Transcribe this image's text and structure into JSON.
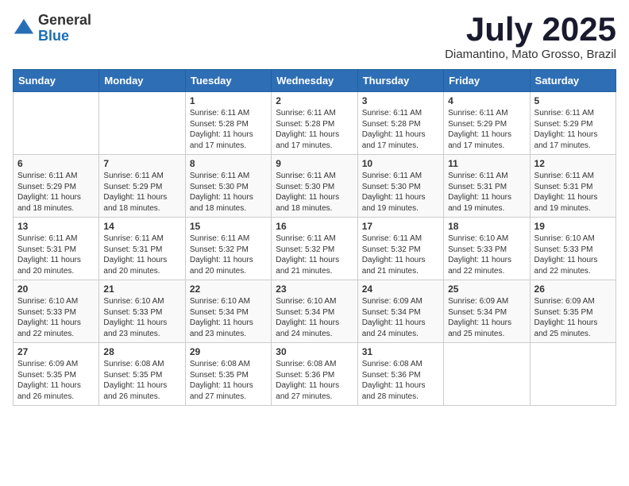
{
  "logo": {
    "general": "General",
    "blue": "Blue"
  },
  "title": "July 2025",
  "location": "Diamantino, Mato Grosso, Brazil",
  "days_of_week": [
    "Sunday",
    "Monday",
    "Tuesday",
    "Wednesday",
    "Thursday",
    "Friday",
    "Saturday"
  ],
  "weeks": [
    [
      {
        "day": "",
        "sunrise": "",
        "sunset": "",
        "daylight": ""
      },
      {
        "day": "",
        "sunrise": "",
        "sunset": "",
        "daylight": ""
      },
      {
        "day": "1",
        "sunrise": "Sunrise: 6:11 AM",
        "sunset": "Sunset: 5:28 PM",
        "daylight": "Daylight: 11 hours and 17 minutes."
      },
      {
        "day": "2",
        "sunrise": "Sunrise: 6:11 AM",
        "sunset": "Sunset: 5:28 PM",
        "daylight": "Daylight: 11 hours and 17 minutes."
      },
      {
        "day": "3",
        "sunrise": "Sunrise: 6:11 AM",
        "sunset": "Sunset: 5:28 PM",
        "daylight": "Daylight: 11 hours and 17 minutes."
      },
      {
        "day": "4",
        "sunrise": "Sunrise: 6:11 AM",
        "sunset": "Sunset: 5:29 PM",
        "daylight": "Daylight: 11 hours and 17 minutes."
      },
      {
        "day": "5",
        "sunrise": "Sunrise: 6:11 AM",
        "sunset": "Sunset: 5:29 PM",
        "daylight": "Daylight: 11 hours and 17 minutes."
      }
    ],
    [
      {
        "day": "6",
        "sunrise": "Sunrise: 6:11 AM",
        "sunset": "Sunset: 5:29 PM",
        "daylight": "Daylight: 11 hours and 18 minutes."
      },
      {
        "day": "7",
        "sunrise": "Sunrise: 6:11 AM",
        "sunset": "Sunset: 5:29 PM",
        "daylight": "Daylight: 11 hours and 18 minutes."
      },
      {
        "day": "8",
        "sunrise": "Sunrise: 6:11 AM",
        "sunset": "Sunset: 5:30 PM",
        "daylight": "Daylight: 11 hours and 18 minutes."
      },
      {
        "day": "9",
        "sunrise": "Sunrise: 6:11 AM",
        "sunset": "Sunset: 5:30 PM",
        "daylight": "Daylight: 11 hours and 18 minutes."
      },
      {
        "day": "10",
        "sunrise": "Sunrise: 6:11 AM",
        "sunset": "Sunset: 5:30 PM",
        "daylight": "Daylight: 11 hours and 19 minutes."
      },
      {
        "day": "11",
        "sunrise": "Sunrise: 6:11 AM",
        "sunset": "Sunset: 5:31 PM",
        "daylight": "Daylight: 11 hours and 19 minutes."
      },
      {
        "day": "12",
        "sunrise": "Sunrise: 6:11 AM",
        "sunset": "Sunset: 5:31 PM",
        "daylight": "Daylight: 11 hours and 19 minutes."
      }
    ],
    [
      {
        "day": "13",
        "sunrise": "Sunrise: 6:11 AM",
        "sunset": "Sunset: 5:31 PM",
        "daylight": "Daylight: 11 hours and 20 minutes."
      },
      {
        "day": "14",
        "sunrise": "Sunrise: 6:11 AM",
        "sunset": "Sunset: 5:31 PM",
        "daylight": "Daylight: 11 hours and 20 minutes."
      },
      {
        "day": "15",
        "sunrise": "Sunrise: 6:11 AM",
        "sunset": "Sunset: 5:32 PM",
        "daylight": "Daylight: 11 hours and 20 minutes."
      },
      {
        "day": "16",
        "sunrise": "Sunrise: 6:11 AM",
        "sunset": "Sunset: 5:32 PM",
        "daylight": "Daylight: 11 hours and 21 minutes."
      },
      {
        "day": "17",
        "sunrise": "Sunrise: 6:11 AM",
        "sunset": "Sunset: 5:32 PM",
        "daylight": "Daylight: 11 hours and 21 minutes."
      },
      {
        "day": "18",
        "sunrise": "Sunrise: 6:10 AM",
        "sunset": "Sunset: 5:33 PM",
        "daylight": "Daylight: 11 hours and 22 minutes."
      },
      {
        "day": "19",
        "sunrise": "Sunrise: 6:10 AM",
        "sunset": "Sunset: 5:33 PM",
        "daylight": "Daylight: 11 hours and 22 minutes."
      }
    ],
    [
      {
        "day": "20",
        "sunrise": "Sunrise: 6:10 AM",
        "sunset": "Sunset: 5:33 PM",
        "daylight": "Daylight: 11 hours and 22 minutes."
      },
      {
        "day": "21",
        "sunrise": "Sunrise: 6:10 AM",
        "sunset": "Sunset: 5:33 PM",
        "daylight": "Daylight: 11 hours and 23 minutes."
      },
      {
        "day": "22",
        "sunrise": "Sunrise: 6:10 AM",
        "sunset": "Sunset: 5:34 PM",
        "daylight": "Daylight: 11 hours and 23 minutes."
      },
      {
        "day": "23",
        "sunrise": "Sunrise: 6:10 AM",
        "sunset": "Sunset: 5:34 PM",
        "daylight": "Daylight: 11 hours and 24 minutes."
      },
      {
        "day": "24",
        "sunrise": "Sunrise: 6:09 AM",
        "sunset": "Sunset: 5:34 PM",
        "daylight": "Daylight: 11 hours and 24 minutes."
      },
      {
        "day": "25",
        "sunrise": "Sunrise: 6:09 AM",
        "sunset": "Sunset: 5:34 PM",
        "daylight": "Daylight: 11 hours and 25 minutes."
      },
      {
        "day": "26",
        "sunrise": "Sunrise: 6:09 AM",
        "sunset": "Sunset: 5:35 PM",
        "daylight": "Daylight: 11 hours and 25 minutes."
      }
    ],
    [
      {
        "day": "27",
        "sunrise": "Sunrise: 6:09 AM",
        "sunset": "Sunset: 5:35 PM",
        "daylight": "Daylight: 11 hours and 26 minutes."
      },
      {
        "day": "28",
        "sunrise": "Sunrise: 6:08 AM",
        "sunset": "Sunset: 5:35 PM",
        "daylight": "Daylight: 11 hours and 26 minutes."
      },
      {
        "day": "29",
        "sunrise": "Sunrise: 6:08 AM",
        "sunset": "Sunset: 5:35 PM",
        "daylight": "Daylight: 11 hours and 27 minutes."
      },
      {
        "day": "30",
        "sunrise": "Sunrise: 6:08 AM",
        "sunset": "Sunset: 5:36 PM",
        "daylight": "Daylight: 11 hours and 27 minutes."
      },
      {
        "day": "31",
        "sunrise": "Sunrise: 6:08 AM",
        "sunset": "Sunset: 5:36 PM",
        "daylight": "Daylight: 11 hours and 28 minutes."
      },
      {
        "day": "",
        "sunrise": "",
        "sunset": "",
        "daylight": ""
      },
      {
        "day": "",
        "sunrise": "",
        "sunset": "",
        "daylight": ""
      }
    ]
  ]
}
